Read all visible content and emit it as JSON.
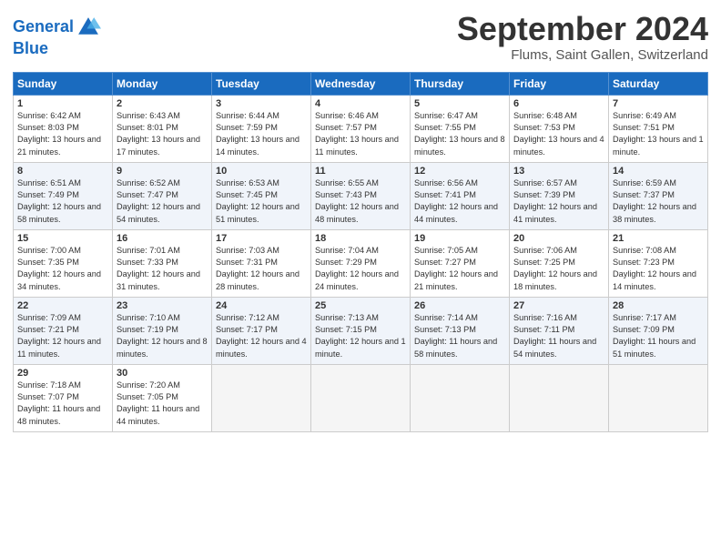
{
  "header": {
    "logo_line1": "General",
    "logo_line2": "Blue",
    "month": "September 2024",
    "location": "Flums, Saint Gallen, Switzerland"
  },
  "columns": [
    "Sunday",
    "Monday",
    "Tuesday",
    "Wednesday",
    "Thursday",
    "Friday",
    "Saturday"
  ],
  "weeks": [
    [
      {
        "day": "1",
        "sunrise": "6:42 AM",
        "sunset": "8:03 PM",
        "daylight": "13 hours and 21 minutes."
      },
      {
        "day": "2",
        "sunrise": "6:43 AM",
        "sunset": "8:01 PM",
        "daylight": "13 hours and 17 minutes."
      },
      {
        "day": "3",
        "sunrise": "6:44 AM",
        "sunset": "7:59 PM",
        "daylight": "13 hours and 14 minutes."
      },
      {
        "day": "4",
        "sunrise": "6:46 AM",
        "sunset": "7:57 PM",
        "daylight": "13 hours and 11 minutes."
      },
      {
        "day": "5",
        "sunrise": "6:47 AM",
        "sunset": "7:55 PM",
        "daylight": "13 hours and 8 minutes."
      },
      {
        "day": "6",
        "sunrise": "6:48 AM",
        "sunset": "7:53 PM",
        "daylight": "13 hours and 4 minutes."
      },
      {
        "day": "7",
        "sunrise": "6:49 AM",
        "sunset": "7:51 PM",
        "daylight": "13 hours and 1 minute."
      }
    ],
    [
      {
        "day": "8",
        "sunrise": "6:51 AM",
        "sunset": "7:49 PM",
        "daylight": "12 hours and 58 minutes."
      },
      {
        "day": "9",
        "sunrise": "6:52 AM",
        "sunset": "7:47 PM",
        "daylight": "12 hours and 54 minutes."
      },
      {
        "day": "10",
        "sunrise": "6:53 AM",
        "sunset": "7:45 PM",
        "daylight": "12 hours and 51 minutes."
      },
      {
        "day": "11",
        "sunrise": "6:55 AM",
        "sunset": "7:43 PM",
        "daylight": "12 hours and 48 minutes."
      },
      {
        "day": "12",
        "sunrise": "6:56 AM",
        "sunset": "7:41 PM",
        "daylight": "12 hours and 44 minutes."
      },
      {
        "day": "13",
        "sunrise": "6:57 AM",
        "sunset": "7:39 PM",
        "daylight": "12 hours and 41 minutes."
      },
      {
        "day": "14",
        "sunrise": "6:59 AM",
        "sunset": "7:37 PM",
        "daylight": "12 hours and 38 minutes."
      }
    ],
    [
      {
        "day": "15",
        "sunrise": "7:00 AM",
        "sunset": "7:35 PM",
        "daylight": "12 hours and 34 minutes."
      },
      {
        "day": "16",
        "sunrise": "7:01 AM",
        "sunset": "7:33 PM",
        "daylight": "12 hours and 31 minutes."
      },
      {
        "day": "17",
        "sunrise": "7:03 AM",
        "sunset": "7:31 PM",
        "daylight": "12 hours and 28 minutes."
      },
      {
        "day": "18",
        "sunrise": "7:04 AM",
        "sunset": "7:29 PM",
        "daylight": "12 hours and 24 minutes."
      },
      {
        "day": "19",
        "sunrise": "7:05 AM",
        "sunset": "7:27 PM",
        "daylight": "12 hours and 21 minutes."
      },
      {
        "day": "20",
        "sunrise": "7:06 AM",
        "sunset": "7:25 PM",
        "daylight": "12 hours and 18 minutes."
      },
      {
        "day": "21",
        "sunrise": "7:08 AM",
        "sunset": "7:23 PM",
        "daylight": "12 hours and 14 minutes."
      }
    ],
    [
      {
        "day": "22",
        "sunrise": "7:09 AM",
        "sunset": "7:21 PM",
        "daylight": "12 hours and 11 minutes."
      },
      {
        "day": "23",
        "sunrise": "7:10 AM",
        "sunset": "7:19 PM",
        "daylight": "12 hours and 8 minutes."
      },
      {
        "day": "24",
        "sunrise": "7:12 AM",
        "sunset": "7:17 PM",
        "daylight": "12 hours and 4 minutes."
      },
      {
        "day": "25",
        "sunrise": "7:13 AM",
        "sunset": "7:15 PM",
        "daylight": "12 hours and 1 minute."
      },
      {
        "day": "26",
        "sunrise": "7:14 AM",
        "sunset": "7:13 PM",
        "daylight": "11 hours and 58 minutes."
      },
      {
        "day": "27",
        "sunrise": "7:16 AM",
        "sunset": "7:11 PM",
        "daylight": "11 hours and 54 minutes."
      },
      {
        "day": "28",
        "sunrise": "7:17 AM",
        "sunset": "7:09 PM",
        "daylight": "11 hours and 51 minutes."
      }
    ],
    [
      {
        "day": "29",
        "sunrise": "7:18 AM",
        "sunset": "7:07 PM",
        "daylight": "11 hours and 48 minutes."
      },
      {
        "day": "30",
        "sunrise": "7:20 AM",
        "sunset": "7:05 PM",
        "daylight": "11 hours and 44 minutes."
      },
      null,
      null,
      null,
      null,
      null
    ]
  ]
}
